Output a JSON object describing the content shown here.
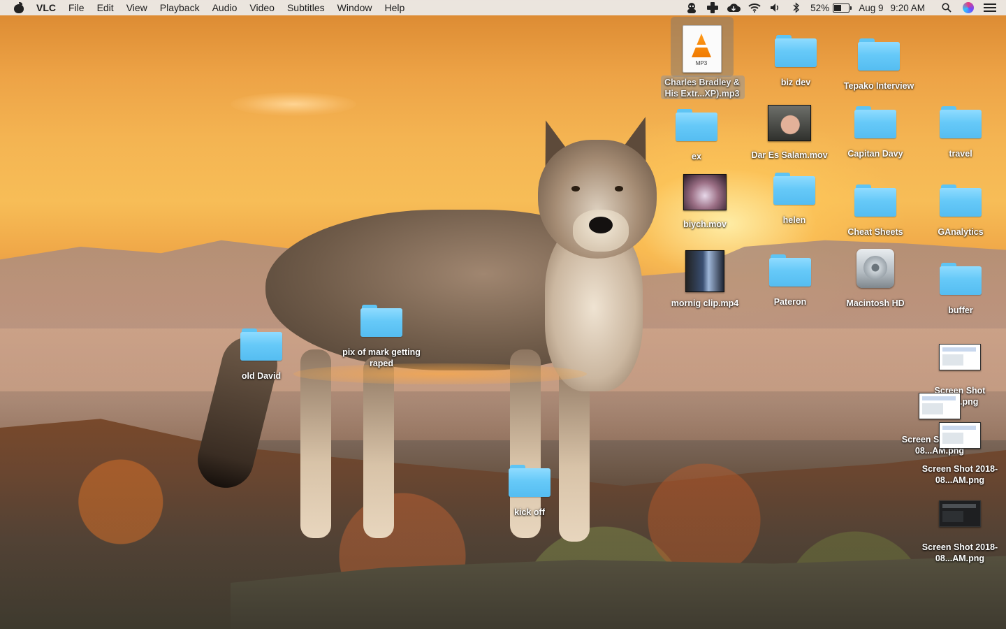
{
  "menubar": {
    "app_name": "VLC",
    "menus": [
      "File",
      "Edit",
      "View",
      "Playback",
      "Audio",
      "Video",
      "Subtitles",
      "Window",
      "Help"
    ],
    "status": {
      "battery_percent": "52%",
      "battery_level": 0.52,
      "date": "Aug 9",
      "time": "9:20 AM",
      "icons": [
        "user-icon",
        "plus-icon",
        "cloud-icon",
        "wifi-icon",
        "volume-icon",
        "bluetooth-icon",
        "battery-icon",
        "spotlight-search-icon",
        "siri-icon",
        "notification-center-icon"
      ]
    }
  },
  "desktop": {
    "items": [
      {
        "label": "Charles Bradley & His Extr...XP).mp3",
        "kind": "mp3",
        "selected": true
      },
      {
        "label": "biz dev",
        "kind": "folder"
      },
      {
        "label": "Tepako Interview",
        "kind": "folder"
      },
      {
        "label": "ex",
        "kind": "folder"
      },
      {
        "label": "Dar Es Salam.mov",
        "kind": "video"
      },
      {
        "label": "Capitan Davy",
        "kind": "folder"
      },
      {
        "label": "travel",
        "kind": "folder"
      },
      {
        "label": "biych.mov",
        "kind": "video"
      },
      {
        "label": "helen",
        "kind": "folder"
      },
      {
        "label": "Cheat Sheets",
        "kind": "folder"
      },
      {
        "label": "GAnalytics",
        "kind": "folder"
      },
      {
        "label": "mornig clip.mp4",
        "kind": "video"
      },
      {
        "label": "Pateron",
        "kind": "folder"
      },
      {
        "label": "Macintosh HD",
        "kind": "drive"
      },
      {
        "label": "buffer",
        "kind": "folder"
      },
      {
        "label": "pix of mark getting raped",
        "kind": "folder"
      },
      {
        "label": "old David",
        "kind": "folder"
      },
      {
        "label": "kick off",
        "kind": "folder"
      },
      {
        "label": "Screen Shot ..AM.png",
        "kind": "screenshot"
      },
      {
        "label": "Screen Shot 2018-08...AM.png",
        "kind": "screenshot"
      },
      {
        "label": "Screen Shot 2018-08...AM.png",
        "kind": "screenshot"
      },
      {
        "label": "Screen Shot 2018-08...AM.png",
        "kind": "screenshot"
      }
    ],
    "mp3_badge": "MP3"
  }
}
